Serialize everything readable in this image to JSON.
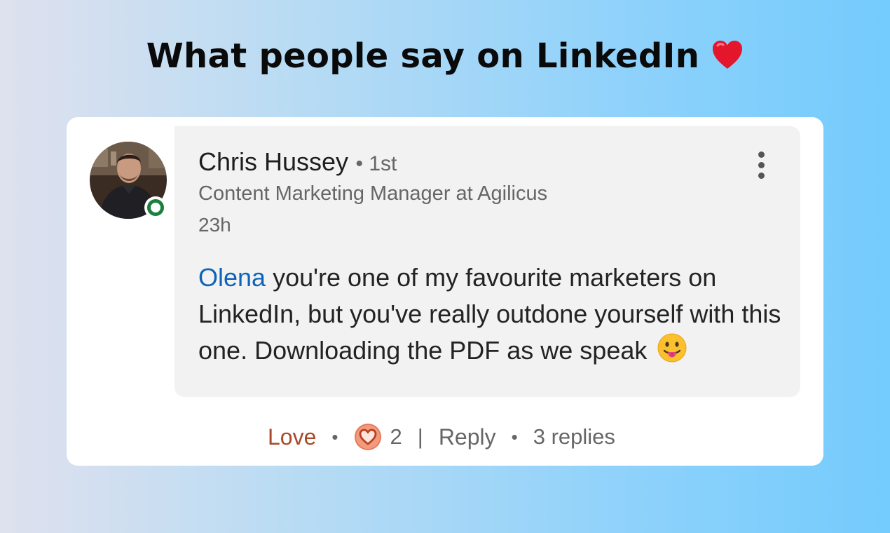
{
  "heading": {
    "text": "What people say on LinkedIn",
    "emoji": "❤️"
  },
  "comment": {
    "author": {
      "name": "Chris Hussey",
      "degree": "1st",
      "online": true
    },
    "headline": "Content Marketing Manager at Agilicus",
    "time": "23h",
    "mention": "Olena",
    "text": "you're one of my favourite marketers on LinkedIn, but you've really outdone yourself with this one. Downloading the PDF as we speak",
    "emoji": "tongue-out-face",
    "degree_separator": "•"
  },
  "actions": {
    "love_label": "Love",
    "dot": "•",
    "reaction_icon": "love-heart-icon",
    "reaction_count": "2",
    "pipe": "|",
    "reply_label": "Reply",
    "replies_label": "3 replies"
  },
  "colors": {
    "mention": "#0f64b8",
    "love": "#a84a2a",
    "presence": "#1b7f3d"
  }
}
